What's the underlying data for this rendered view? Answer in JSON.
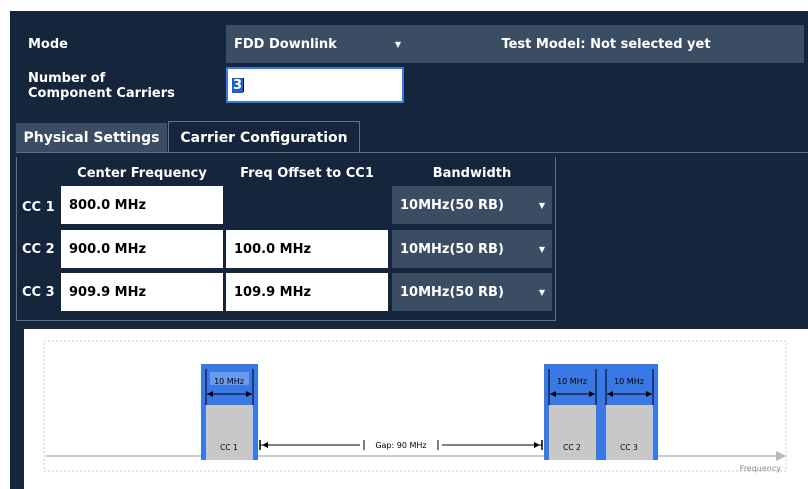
{
  "mode": {
    "label": "Mode",
    "value": "FDD Downlink",
    "test_model": "Test Model: Not selected yet"
  },
  "component_carriers": {
    "label_line1": "Number of",
    "label_line2": "Component Carriers",
    "value": "3"
  },
  "tabs": [
    {
      "label": "Physical Settings",
      "active": false
    },
    {
      "label": "Carrier Configuration",
      "active": true
    }
  ],
  "table": {
    "headers": {
      "center": "Center Frequency",
      "offset": "Freq Offset to CC1",
      "bandwidth": "Bandwidth"
    },
    "rows": [
      {
        "label": "CC 1",
        "center": "800.0 MHz",
        "offset": "",
        "bandwidth": "10MHz(50 RB)"
      },
      {
        "label": "CC 2",
        "center": "900.0 MHz",
        "offset": "100.0 MHz",
        "bandwidth": "10MHz(50 RB)"
      },
      {
        "label": "CC 3",
        "center": "909.9 MHz",
        "offset": "109.9 MHz",
        "bandwidth": "10MHz(50 RB)"
      }
    ]
  },
  "diagram": {
    "carriers": [
      {
        "name": "CC 1",
        "bw": "10 MHz"
      },
      {
        "name": "CC 2",
        "bw": "10 MHz"
      },
      {
        "name": "CC 3",
        "bw": "10 MHz"
      }
    ],
    "gap": "Gap: 90 MHz",
    "axis_label": "Frequency"
  },
  "colors": {
    "panel": "#15253b",
    "control": "#3b4d63",
    "carrier_blue": "#3a78e6",
    "carrier_gray": "#c8c8c8"
  }
}
